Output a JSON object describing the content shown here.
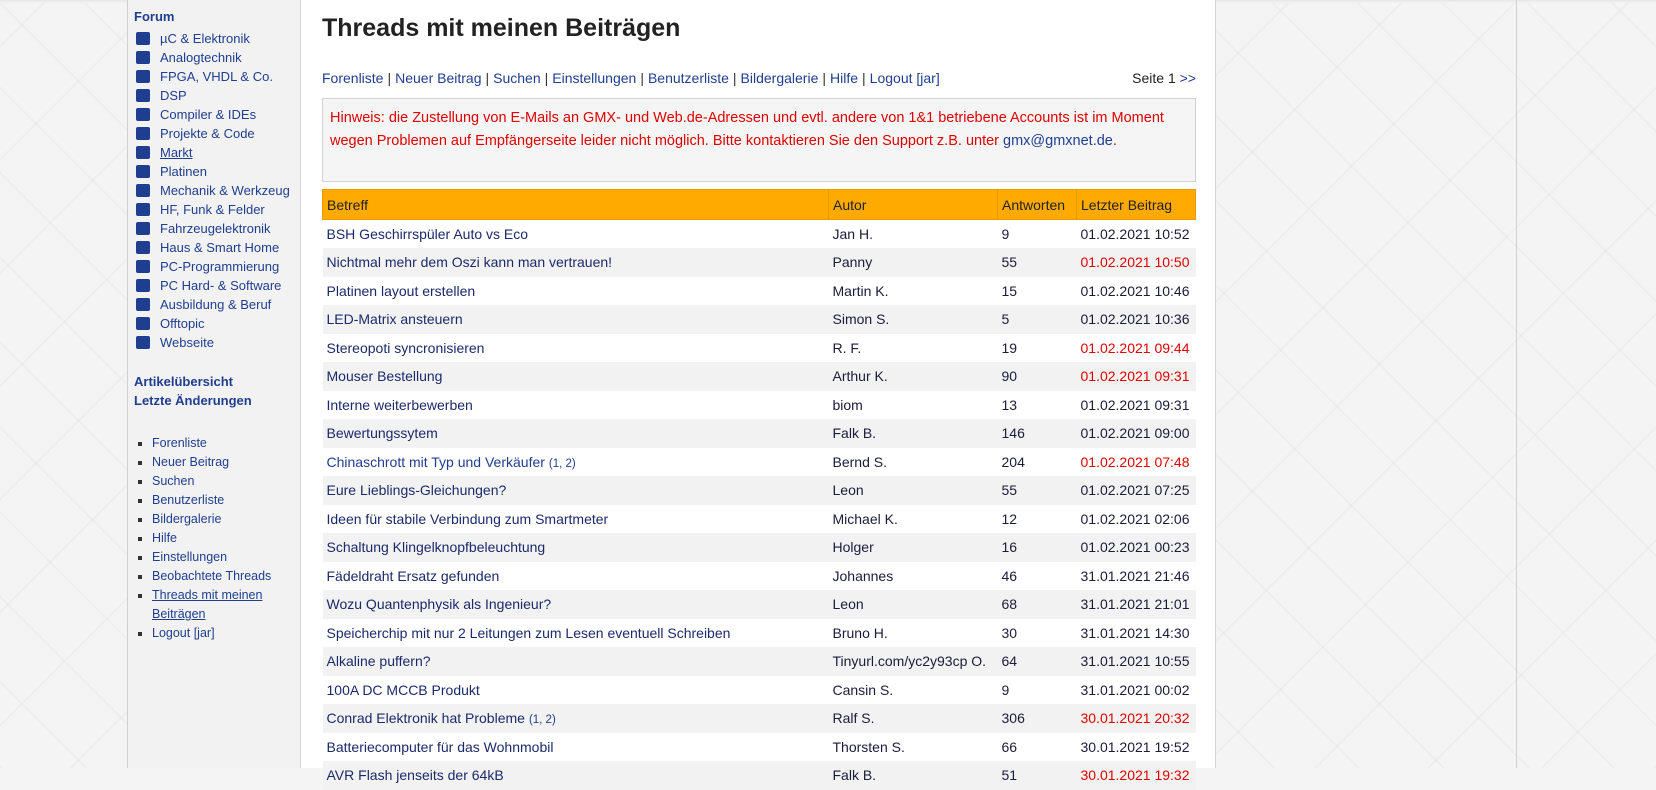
{
  "sidebar": {
    "forum_title": "Forum",
    "forums": [
      {
        "label": "µC & Elektronik",
        "icon": "chip-icon"
      },
      {
        "label": "Analogtechnik",
        "icon": "circuit-icon"
      },
      {
        "label": "FPGA, VHDL & Co.",
        "icon": "fpga-icon"
      },
      {
        "label": "DSP",
        "icon": "signal-icon"
      },
      {
        "label": "Compiler & IDEs",
        "icon": "monitor-icon"
      },
      {
        "label": "Projekte & Code",
        "icon": "board-icon"
      },
      {
        "label": "Markt",
        "icon": "cart-icon",
        "underline": true
      },
      {
        "label": "Platinen",
        "icon": "pcb-icon"
      },
      {
        "label": "Mechanik & Werkzeug",
        "icon": "wrench-icon"
      },
      {
        "label": "HF, Funk & Felder",
        "icon": "antenna-icon"
      },
      {
        "label": "Fahrzeugelektronik",
        "icon": "car-icon"
      },
      {
        "label": "Haus & Smart Home",
        "icon": "house-icon"
      },
      {
        "label": "PC-Programmierung",
        "icon": "code-icon"
      },
      {
        "label": "PC Hard- & Software",
        "icon": "laptop-icon"
      },
      {
        "label": "Ausbildung & Beruf",
        "icon": "book-icon"
      },
      {
        "label": "Offtopic",
        "icon": "chat-icon"
      },
      {
        "label": "Webseite",
        "icon": "globe-icon"
      }
    ],
    "articles": [
      "Artikelübersicht",
      "Letzte Änderungen"
    ],
    "nav": [
      {
        "label": "Forenliste"
      },
      {
        "label": "Neuer Beitrag"
      },
      {
        "label": "Suchen"
      },
      {
        "label": "Benutzerliste"
      },
      {
        "label": "Bildergalerie"
      },
      {
        "label": "Hilfe"
      },
      {
        "label": "Einstellungen"
      },
      {
        "label": "Beobachtete Threads"
      },
      {
        "label": "Threads mit meinen Beiträgen",
        "active": true
      },
      {
        "label": "Logout [jar]"
      }
    ]
  },
  "main": {
    "title": "Threads mit meinen Beiträgen",
    "topnav": [
      "Forenliste",
      "Neuer Beitrag",
      "Suchen",
      "Einstellungen",
      "Benutzerliste",
      "Bildergalerie",
      "Hilfe",
      "Logout [jar]"
    ],
    "page_label": "Seite 1",
    "next_label": ">>",
    "notice_text": "Hinweis: die Zustellung von E-Mails an GMX- und Web.de-Adressen und evtl. andere von 1&1 betriebene Accounts ist im Moment wegen Problemen auf Empfängerseite leider nicht möglich. Bitte kontaktieren Sie den Support z.B. unter",
    "notice_link": "gmx@gmxnet.de",
    "notice_end": ".",
    "columns": [
      "Betreff",
      "Autor",
      "Antworten",
      "Letzter Beitrag"
    ],
    "threads": [
      {
        "subject": "BSH Geschirrspüler Auto vs Eco",
        "author": "Jan H.",
        "answers": "9",
        "last": "01.02.2021 10:52",
        "new": false
      },
      {
        "subject": "Nichtmal mehr dem Oszi kann man vertrauen!",
        "author": "Panny",
        "answers": "55",
        "last": "01.02.2021 10:50",
        "new": true
      },
      {
        "subject": "Platinen layout erstellen",
        "author": "Martin K.",
        "answers": "15",
        "last": "01.02.2021 10:46",
        "new": false
      },
      {
        "subject": "LED-Matrix ansteuern",
        "author": "Simon S.",
        "answers": "5",
        "last": "01.02.2021 10:36",
        "new": false
      },
      {
        "subject": "Stereopoti syncronisieren",
        "author": "R. F.",
        "answers": "19",
        "last": "01.02.2021 09:44",
        "new": true
      },
      {
        "subject": "Mouser Bestellung",
        "author": "Arthur K.",
        "answers": "90",
        "last": "01.02.2021 09:31",
        "new": true
      },
      {
        "subject": "Interne weiterbewerben",
        "author": "biom",
        "answers": "13",
        "last": "01.02.2021 09:31",
        "new": false
      },
      {
        "subject": "Bewertungssytem",
        "author": "Falk B.",
        "answers": "146",
        "last": "01.02.2021 09:00",
        "new": false
      },
      {
        "subject": "Chinaschrott mit Typ und Verkäufer",
        "pages": "(1, 2)",
        "author": "Bernd S.",
        "answers": "204",
        "last": "01.02.2021 07:48",
        "new": true,
        "blue": true
      },
      {
        "subject": "Eure Lieblings-Gleichungen?",
        "author": "Leon",
        "answers": "55",
        "last": "01.02.2021 07:25",
        "new": false
      },
      {
        "subject": "Ideen für stabile Verbindung zum Smartmeter",
        "author": "Michael K.",
        "answers": "12",
        "last": "01.02.2021 02:06",
        "new": false
      },
      {
        "subject": "Schaltung Klingelknopfbeleuchtung",
        "author": "Holger",
        "answers": "16",
        "last": "01.02.2021 00:23",
        "new": false
      },
      {
        "subject": "Fädeldraht Ersatz gefunden",
        "author": "Johannes",
        "answers": "46",
        "last": "31.01.2021 21:46",
        "new": false
      },
      {
        "subject": "Wozu Quantenphysik als Ingenieur?",
        "author": "Leon",
        "answers": "68",
        "last": "31.01.2021 21:01",
        "new": false
      },
      {
        "subject": "Speicherchip mit nur 2 Leitungen zum Lesen eventuell Schreiben",
        "author": "Bruno H.",
        "answers": "30",
        "last": "31.01.2021 14:30",
        "new": false
      },
      {
        "subject": "Alkaline puffern?",
        "author": "Tinyurl.com/yc2y93cp O.",
        "answers": "64",
        "last": "31.01.2021 10:55",
        "new": false
      },
      {
        "subject": "100A DC MCCB Produkt",
        "author": "Cansin S.",
        "answers": "9",
        "last": "31.01.2021 00:02",
        "new": false
      },
      {
        "subject": "Conrad Elektronik hat Probleme",
        "pages": "(1, 2)",
        "author": "Ralf S.",
        "answers": "306",
        "last": "30.01.2021 20:32",
        "new": true
      },
      {
        "subject": "Batteriecomputer für das Wohnmobil",
        "author": "Thorsten S.",
        "answers": "66",
        "last": "30.01.2021 19:52",
        "new": false
      },
      {
        "subject": "AVR Flash jenseits der 64kB",
        "author": "Falk B.",
        "answers": "51",
        "last": "30.01.2021 19:32",
        "new": true
      }
    ]
  }
}
